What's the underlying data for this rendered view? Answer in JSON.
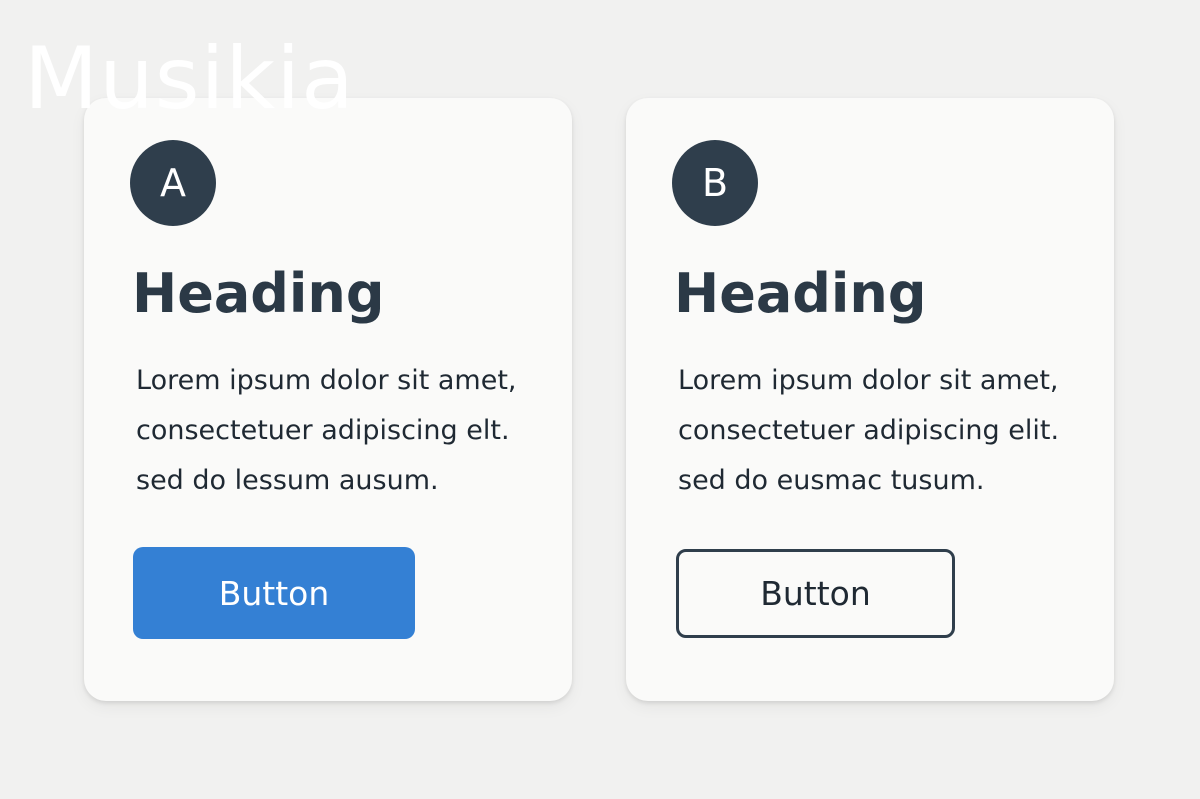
{
  "watermark": "Musikia",
  "cards": [
    {
      "badge": "A",
      "heading": "Heading",
      "body_lines": [
        "Lorem ipsum dolor sit amet,",
        "consectetuer adipiscing elt.",
        "sed do lessum ausum."
      ],
      "button_label": "Button",
      "button_style": "filled",
      "button_color": "#3480d4"
    },
    {
      "badge": "B",
      "heading": "Heading",
      "body_lines": [
        "Lorem ipsum dolor sit amet,",
        "consectetuer adipiscing elit.",
        "sed do eusmac tusum."
      ],
      "button_label": "Button",
      "button_style": "outline",
      "button_color": "#2f3e4c"
    }
  ],
  "colors": {
    "badge": "#2f3e4c",
    "heading": "#2b3946",
    "background": "#f1f1f0",
    "card": "#fafaf9"
  }
}
